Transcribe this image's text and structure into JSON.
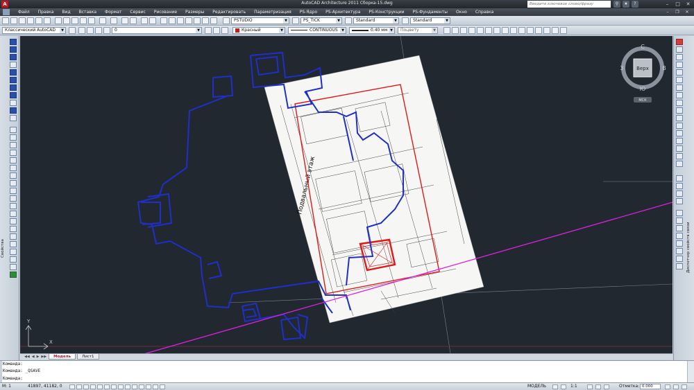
{
  "window": {
    "title": "AutoCAD Architecture 2011   Сборка-15.dwg",
    "search_placeholder": "Введите ключевое слово/фразу"
  },
  "menu": [
    "Файл",
    "Правка",
    "Вид",
    "Вставка",
    "Формат",
    "Сервис",
    "Рисование",
    "Размеры",
    "Редактировать",
    "Параметризация",
    "PS-Ядро",
    "PS-Архитектура",
    "PS-Конструкции",
    "PS-Фундаменты",
    "Окно",
    "Справка"
  ],
  "toolbar": {
    "workspace": "Классический AutoCAD",
    "style_ps": "PSTUDIO",
    "style_tick": "PS_TICK",
    "text_style": "Standard",
    "table_style": "Standard"
  },
  "properties": {
    "workspace": "Классический AutoCAD",
    "layer": "0",
    "color": "Красный",
    "linetype": "CONTINUOUS",
    "lineweight": "0.40 мм",
    "plotstyle": "Поцвету"
  },
  "drawing": {
    "sheet_label": "Подвальный этаж"
  },
  "viewcube": {
    "top": "Верх",
    "north": "С",
    "south": "Ю",
    "east": "В",
    "west": "З",
    "wcs": "МСК"
  },
  "tabs": [
    "Модель",
    "Лист1"
  ],
  "command_lines": [
    "Команда:",
    "Команда:  _QSAVE",
    "Команда:"
  ],
  "status": {
    "m1": "М: 1",
    "coords": "41897, 41182, 0",
    "model": "МОДЕЛЬ",
    "scale": "1:1",
    "mark_label": "Отметка:",
    "mark_value": "0.000"
  },
  "colors": {
    "canvas": "#212830",
    "plan_outline": "#1f2fc8",
    "selection_red": "#e01818",
    "guide_line": "#e020e0"
  }
}
